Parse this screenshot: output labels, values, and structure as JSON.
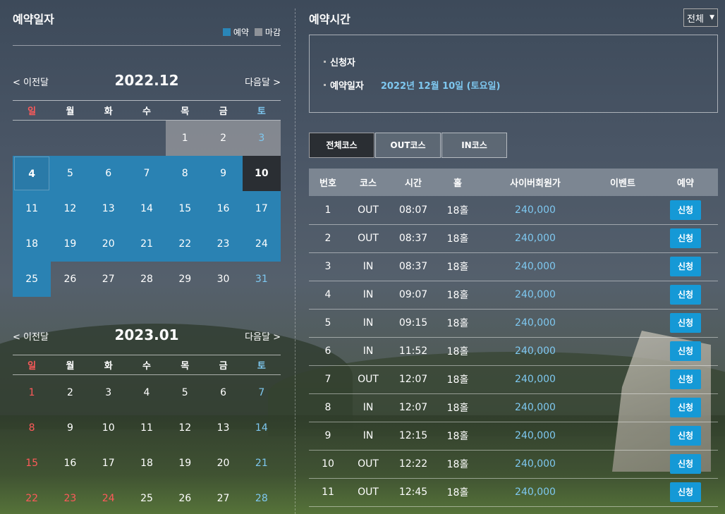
{
  "left": {
    "title": "예약일자",
    "legend": {
      "reserve": "예약",
      "closed": "마감"
    },
    "calendars": [
      {
        "prev": "< 이전달",
        "next": "다음달 >",
        "month": "2022.12",
        "weekdays": [
          "일",
          "월",
          "화",
          "수",
          "목",
          "금",
          "토"
        ],
        "weeks": [
          [
            "",
            "",
            "",
            "",
            "1",
            "2",
            "3"
          ],
          [
            "4",
            "5",
            "6",
            "7",
            "8",
            "9",
            "10"
          ],
          [
            "11",
            "12",
            "13",
            "14",
            "15",
            "16",
            "17"
          ],
          [
            "18",
            "19",
            "20",
            "21",
            "22",
            "23",
            "24"
          ],
          [
            "25",
            "26",
            "27",
            "28",
            "29",
            "30",
            "31"
          ]
        ]
      },
      {
        "prev": "< 이전달",
        "next": "다음달 >",
        "month": "2023.01",
        "weekdays": [
          "일",
          "월",
          "화",
          "수",
          "목",
          "금",
          "토"
        ],
        "weeks": [
          [
            "1",
            "2",
            "3",
            "4",
            "5",
            "6",
            "7"
          ],
          [
            "8",
            "9",
            "10",
            "11",
            "12",
            "13",
            "14"
          ],
          [
            "15",
            "16",
            "17",
            "18",
            "19",
            "20",
            "21"
          ],
          [
            "22",
            "23",
            "24",
            "25",
            "26",
            "27",
            "28"
          ]
        ]
      }
    ]
  },
  "right": {
    "title": "예약시간",
    "filter": "전체",
    "info": {
      "applicant_label": "신청자",
      "date_label": "예약일자",
      "date_value": "2022년 12월 10일 (토요일)"
    },
    "tabs": [
      "전체코스",
      "OUT코스",
      "IN코스"
    ],
    "table": {
      "headers": [
        "번호",
        "코스",
        "시간",
        "홀",
        "사이버회원가",
        "이벤트",
        "예약"
      ],
      "apply_label": "신청",
      "rows": [
        [
          "1",
          "OUT",
          "08:07",
          "18홀",
          "240,000",
          ""
        ],
        [
          "2",
          "OUT",
          "08:37",
          "18홀",
          "240,000",
          ""
        ],
        [
          "3",
          "IN",
          "08:37",
          "18홀",
          "240,000",
          ""
        ],
        [
          "4",
          "IN",
          "09:07",
          "18홀",
          "240,000",
          ""
        ],
        [
          "5",
          "IN",
          "09:15",
          "18홀",
          "240,000",
          ""
        ],
        [
          "6",
          "IN",
          "11:52",
          "18홀",
          "240,000",
          ""
        ],
        [
          "7",
          "OUT",
          "12:07",
          "18홀",
          "240,000",
          ""
        ],
        [
          "8",
          "IN",
          "12:07",
          "18홀",
          "240,000",
          ""
        ],
        [
          "9",
          "IN",
          "12:15",
          "18홀",
          "240,000",
          ""
        ],
        [
          "10",
          "OUT",
          "12:22",
          "18홀",
          "240,000",
          ""
        ],
        [
          "11",
          "OUT",
          "12:45",
          "18홀",
          "240,000",
          ""
        ]
      ]
    }
  },
  "colors": {
    "reserve": "#2a82b3",
    "closed": "#8e9298",
    "selected": "#2a2e33",
    "sunday": "#ff5a5a",
    "saturday": "#7ec8f0",
    "price": "#7ec8f0",
    "apply_button": "#1599d6"
  }
}
